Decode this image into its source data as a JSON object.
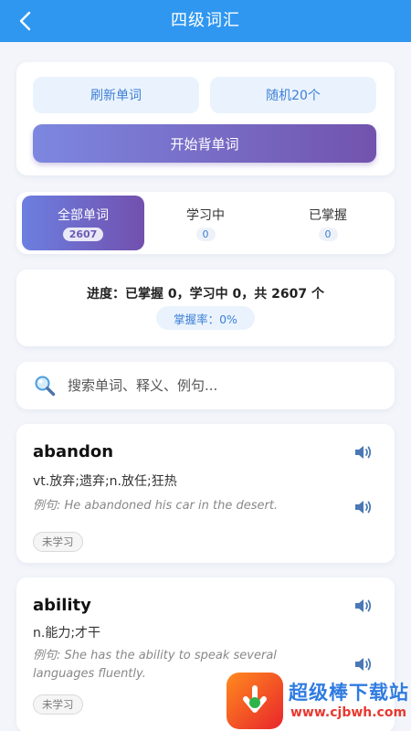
{
  "header": {
    "title": "四级词汇"
  },
  "actions": {
    "refresh_label": "刷新单词",
    "random_label": "随机20个",
    "start_label": "开始背单词"
  },
  "tabs": [
    {
      "label": "全部单词",
      "count": "2607"
    },
    {
      "label": "学习中",
      "count": "0"
    },
    {
      "label": "已掌握",
      "count": "0"
    }
  ],
  "progress": {
    "text": "进度：已掌握 0，学习中 0，共 2607 个",
    "rate": "掌握率：0%"
  },
  "search": {
    "placeholder": "搜索单词、释义、例句..."
  },
  "words": [
    {
      "word": "abandon",
      "meaning": "vt.放弃;遗弃;n.放任;狂热",
      "example": "例句: He abandoned his car in the desert.",
      "status": "未学习"
    },
    {
      "word": "ability",
      "meaning": "n.能力;才干",
      "example": "例句: She has the ability to speak several languages fluently.",
      "status": "未学习"
    }
  ],
  "watermark": {
    "title": "超级棒下载站",
    "url": "www.cjbwh.com"
  },
  "colors": {
    "header": "#2f97f0",
    "accent_start": "#7d87e0",
    "accent_end": "#7253ad",
    "soft_button": "#eaf3fd",
    "link_text": "#3d7fd6"
  },
  "icons": {
    "back": "chevron-left-icon",
    "search": "magnifier-icon",
    "speaker": "speaker-icon",
    "watermark_logo": "download-logo"
  }
}
